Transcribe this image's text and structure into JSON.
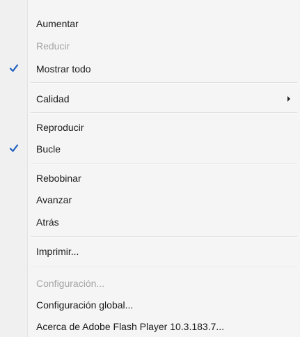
{
  "menu": {
    "items": [
      {
        "label": "Aumentar",
        "enabled": true,
        "checked": false
      },
      {
        "label": "Reducir",
        "enabled": false,
        "checked": false
      },
      {
        "label": "Mostrar todo",
        "enabled": true,
        "checked": true
      },
      {
        "label": "Calidad",
        "enabled": true,
        "checked": false,
        "submenu": true
      },
      {
        "label": "Reproducir",
        "enabled": true,
        "checked": false
      },
      {
        "label": "Bucle",
        "enabled": true,
        "checked": true
      },
      {
        "label": "Rebobinar",
        "enabled": true,
        "checked": false
      },
      {
        "label": "Avanzar",
        "enabled": true,
        "checked": false
      },
      {
        "label": "Atrás",
        "enabled": true,
        "checked": false
      },
      {
        "label": "Imprimir...",
        "enabled": true,
        "checked": false
      },
      {
        "label": "Configuración...",
        "enabled": false,
        "checked": false
      },
      {
        "label": "Configuración global...",
        "enabled": true,
        "checked": false
      },
      {
        "label": "Acerca de Adobe Flash Player 10.3.183.7...",
        "enabled": true,
        "checked": false
      }
    ]
  },
  "icons": {
    "check": "checkmark-icon",
    "submenu": "chevron-right-icon"
  },
  "colors": {
    "text": "#1a1a1a",
    "disabled_text": "#a5a5a5",
    "check": "#1f5fbf",
    "background": "#f5f5f5"
  }
}
